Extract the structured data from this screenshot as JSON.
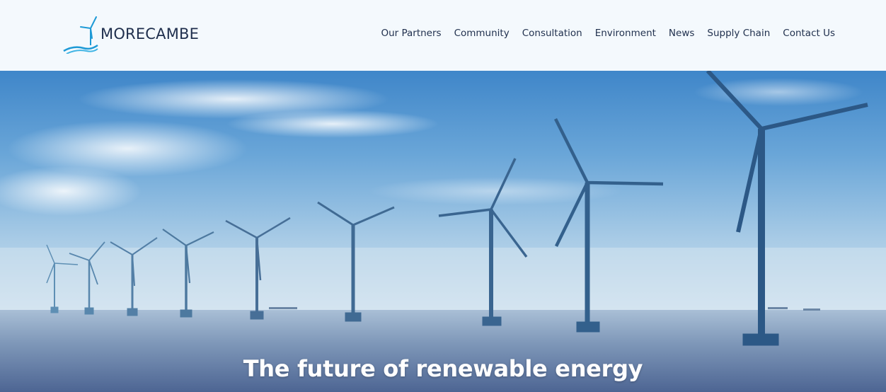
{
  "brand": {
    "name": "MORECAMBE",
    "logo_icon": "wind-turbine-wave-logo",
    "accent_color": "#1e9ad6",
    "text_color": "#1f2f4d"
  },
  "nav": {
    "items": [
      {
        "label": "Our Partners"
      },
      {
        "label": "Community"
      },
      {
        "label": "Consultation"
      },
      {
        "label": "Environment"
      },
      {
        "label": "News"
      },
      {
        "label": "Supply Chain"
      },
      {
        "label": "Contact Us"
      }
    ]
  },
  "hero": {
    "title": "The future of renewable energy",
    "image": "offshore-wind-farm-photo"
  }
}
